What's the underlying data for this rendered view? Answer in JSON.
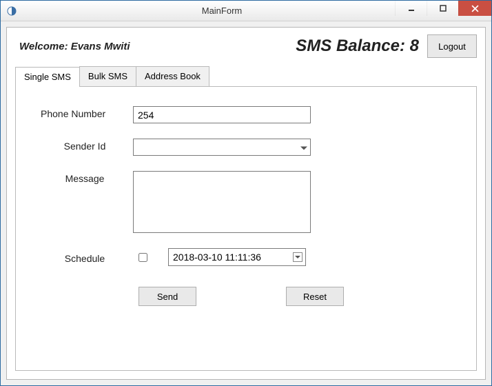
{
  "window": {
    "title": "MainForm"
  },
  "header": {
    "welcome": "Welcome: Evans Mwiti",
    "balance": "SMS Balance: 8",
    "logout": "Logout"
  },
  "tabs": [
    {
      "label": "Single SMS",
      "active": true
    },
    {
      "label": "Bulk SMS",
      "active": false
    },
    {
      "label": "Address Book",
      "active": false
    }
  ],
  "form": {
    "phone": {
      "label": "Phone Number",
      "value": "254"
    },
    "sender": {
      "label": "Sender Id",
      "value": ""
    },
    "message": {
      "label": "Message",
      "value": ""
    },
    "schedule": {
      "label": "Schedule",
      "checked": false,
      "datetime": "2018-03-10 11:11:36"
    },
    "buttons": {
      "send": "Send",
      "reset": "Reset"
    }
  }
}
